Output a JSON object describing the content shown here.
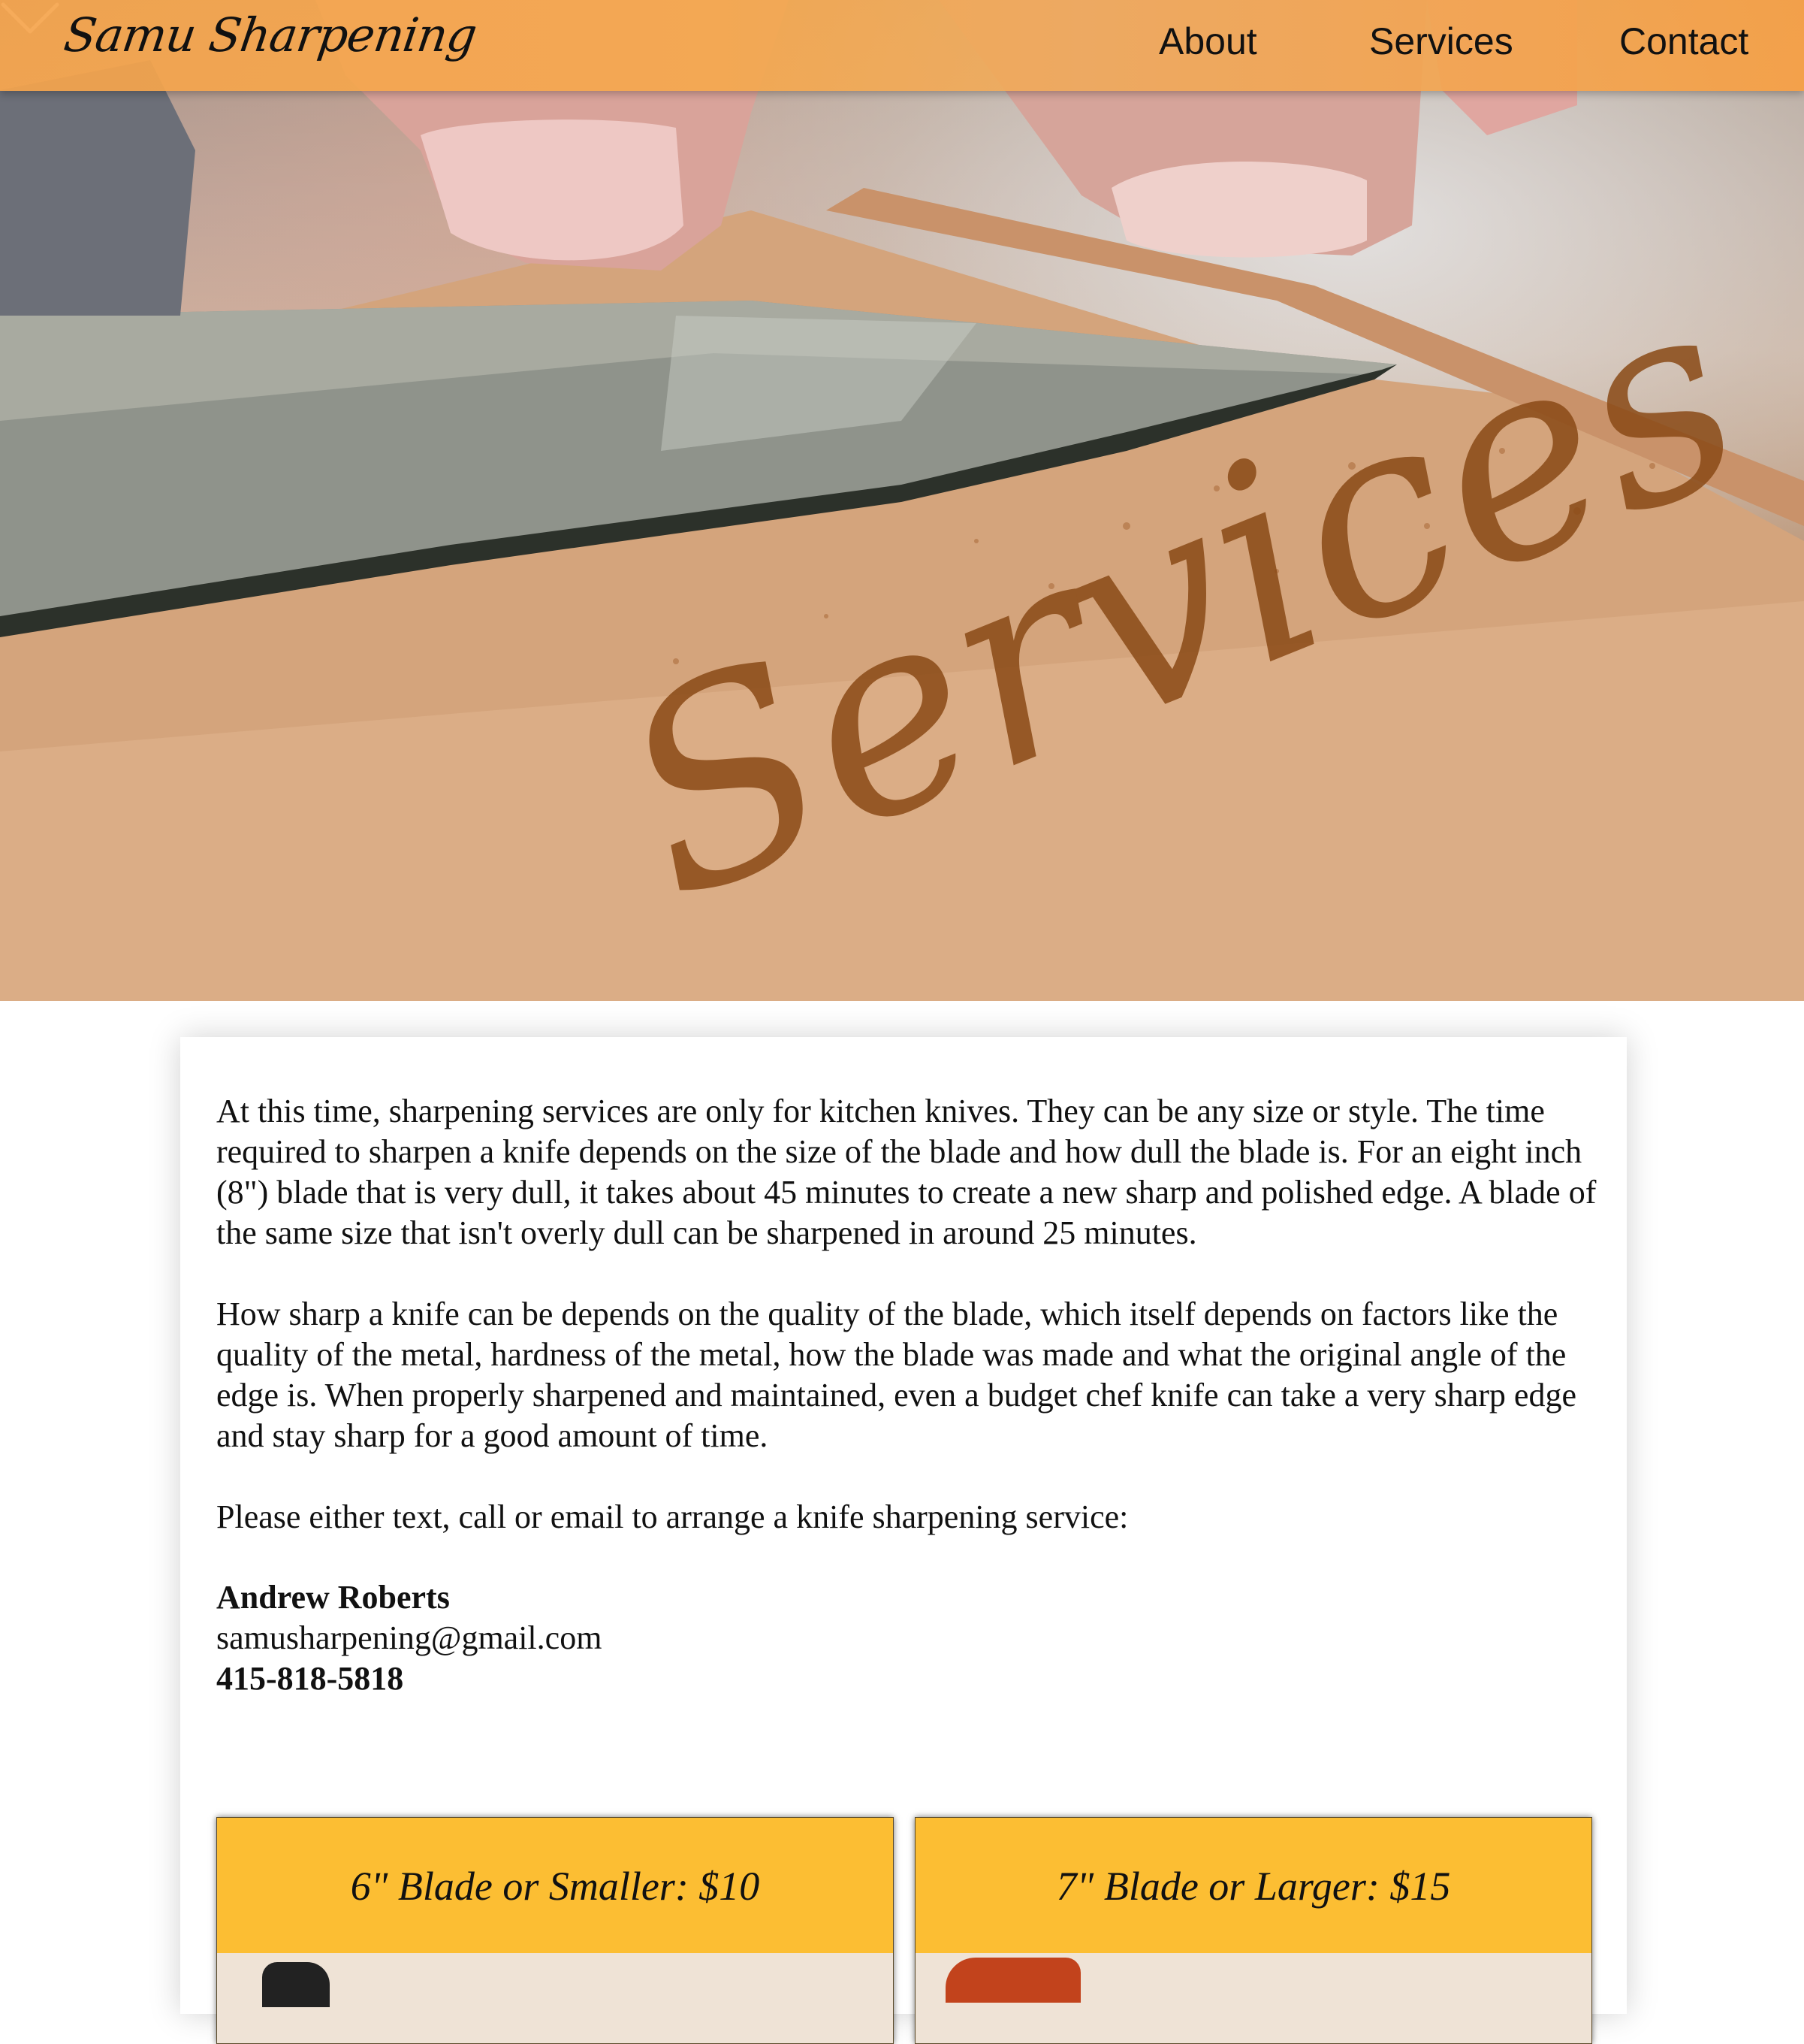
{
  "nav": {
    "brand": "Samu Sharpening",
    "items": [
      "About",
      "Services",
      "Contact"
    ]
  },
  "hero": {
    "stone_text": "Services",
    "chevron_icon": "chevron-down-icon"
  },
  "content": {
    "paragraphs": [
      "At this time, sharpening services are only for kitchen knives. They can be any size or style. The time required to sharpen a knife depends on the size of the blade and how dull the blade is. For an eight inch (8\") blade that is very dull, it takes about 45 minutes to create a new sharp and polished edge. A blade of the same size that isn't overly dull can be sharpened in around 25 minutes.",
      "How sharp a knife can be depends on the quality of the blade, which itself depends on factors like the quality of the metal, hardness of the metal, how the blade was made and what the original angle of the edge is. When properly sharpened and maintained, even a budget chef knife can take a very sharp edge and stay sharp for a good amount of time.",
      "Please either text, call or email to arrange a knife sharpening service:"
    ],
    "contact": {
      "name": "Andrew Roberts",
      "email": "samusharpening@gmail.com",
      "phone": "415-818-5818"
    },
    "pricing": [
      {
        "title": "6\" Blade or Smaller: $10"
      },
      {
        "title": "7\" Blade or Larger: $15"
      }
    ]
  },
  "colors": {
    "navbar": "#f5a44c",
    "price_box": "#fcbe33",
    "text": "#111111"
  }
}
